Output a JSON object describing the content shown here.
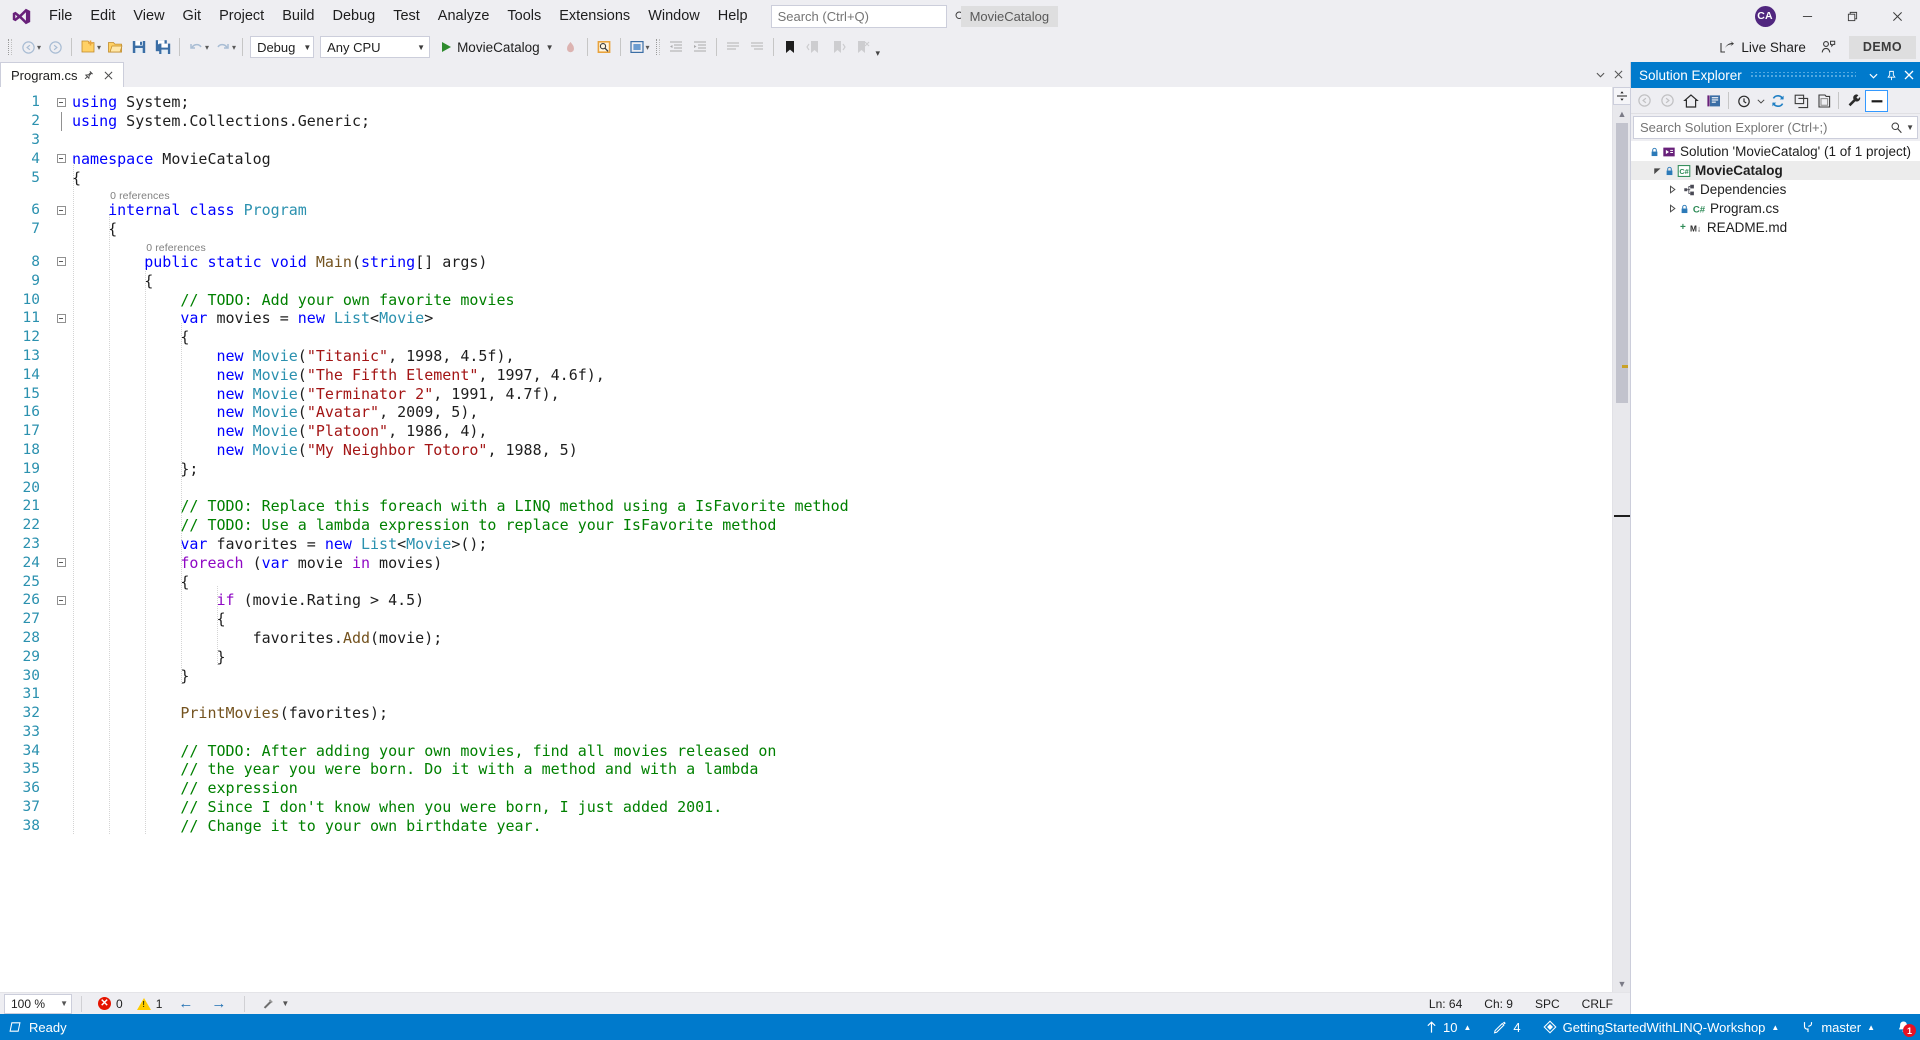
{
  "window": {
    "app_name": "Visual Studio",
    "solution_chip": "MovieCatalog",
    "avatar_initials": "CA",
    "minimize": "─",
    "maximize": "❐",
    "close": "✕"
  },
  "menu": {
    "items": [
      {
        "label": "File",
        "accel": "F"
      },
      {
        "label": "Edit",
        "accel": "E"
      },
      {
        "label": "View",
        "accel": "V"
      },
      {
        "label": "Git",
        "accel": "G"
      },
      {
        "label": "Project",
        "accel": "P"
      },
      {
        "label": "Build",
        "accel": "B"
      },
      {
        "label": "Debug",
        "accel": "D"
      },
      {
        "label": "Test",
        "accel": "T"
      },
      {
        "label": "Analyze",
        "accel": "n"
      },
      {
        "label": "Tools",
        "accel": "T"
      },
      {
        "label": "Extensions",
        "accel": "x"
      },
      {
        "label": "Window",
        "accel": "W"
      },
      {
        "label": "Help",
        "accel": "H"
      }
    ],
    "search_placeholder": "Search (Ctrl+Q)"
  },
  "toolbar": {
    "configuration": "Debug",
    "platform": "Any CPU",
    "start_project": "MovieCatalog",
    "live_share": "Live Share",
    "demo_label": "DEMO"
  },
  "tabs": {
    "active": "Program.cs",
    "pin_tooltip": "Pin Tab",
    "close_tooltip": "Close"
  },
  "editor": {
    "zoom": "100 %",
    "error_count": "0",
    "warning_count": "1",
    "line": "Ln: 64",
    "column": "Ch: 9",
    "spaces": "SPC",
    "line_endings": "CRLF",
    "first_line_number": 1,
    "lines": [
      {
        "n": 1,
        "fold": "minus",
        "indent": 0,
        "tokens": [
          {
            "t": "using",
            "c": "k"
          },
          {
            "t": " System;",
            "c": "p"
          }
        ]
      },
      {
        "n": 2,
        "fold": "bar",
        "indent": 0,
        "tokens": [
          {
            "t": "using",
            "c": "k"
          },
          {
            "t": " System.Collections.Generic;",
            "c": "p"
          }
        ]
      },
      {
        "n": 3,
        "fold": "",
        "indent": 0,
        "tokens": []
      },
      {
        "n": 4,
        "fold": "minus",
        "indent": 0,
        "tokens": [
          {
            "t": "namespace",
            "c": "k"
          },
          {
            "t": " MovieCatalog",
            "c": "p"
          }
        ]
      },
      {
        "n": 5,
        "fold": "",
        "indent": 0,
        "tokens": [
          {
            "t": "{",
            "c": "p"
          }
        ]
      },
      {
        "n": null,
        "codelens": "0 references",
        "indent": 1
      },
      {
        "n": 6,
        "fold": "minus",
        "indent": 1,
        "tokens": [
          {
            "t": "    ",
            "c": "p"
          },
          {
            "t": "internal class",
            "c": "k"
          },
          {
            "t": " ",
            "c": "p"
          },
          {
            "t": "Program",
            "c": "t"
          }
        ]
      },
      {
        "n": 7,
        "fold": "",
        "indent": 1,
        "tokens": [
          {
            "t": "    {",
            "c": "p"
          }
        ]
      },
      {
        "n": null,
        "codelens": "0 references",
        "indent": 2
      },
      {
        "n": 8,
        "fold": "minus",
        "indent": 2,
        "tokens": [
          {
            "t": "        ",
            "c": "p"
          },
          {
            "t": "public static void",
            "c": "k"
          },
          {
            "t": " ",
            "c": "p"
          },
          {
            "t": "Main",
            "c": "m"
          },
          {
            "t": "(",
            "c": "p"
          },
          {
            "t": "string",
            "c": "k"
          },
          {
            "t": "[] args)",
            "c": "p"
          }
        ]
      },
      {
        "n": 9,
        "fold": "",
        "indent": 2,
        "tokens": [
          {
            "t": "        {",
            "c": "p"
          }
        ]
      },
      {
        "n": 10,
        "fold": "",
        "indent": 3,
        "tokens": [
          {
            "t": "            ",
            "c": "p"
          },
          {
            "t": "// TODO: Add your own favorite movies",
            "c": "c"
          }
        ]
      },
      {
        "n": 11,
        "fold": "minus",
        "indent": 3,
        "tokens": [
          {
            "t": "            ",
            "c": "p"
          },
          {
            "t": "var",
            "c": "k"
          },
          {
            "t": " movies = ",
            "c": "p"
          },
          {
            "t": "new",
            "c": "k"
          },
          {
            "t": " ",
            "c": "p"
          },
          {
            "t": "List",
            "c": "t"
          },
          {
            "t": "<",
            "c": "p"
          },
          {
            "t": "Movie",
            "c": "t"
          },
          {
            "t": ">",
            "c": "p"
          }
        ]
      },
      {
        "n": 12,
        "fold": "",
        "indent": 3,
        "tokens": [
          {
            "t": "            {",
            "c": "p"
          }
        ]
      },
      {
        "n": 13,
        "fold": "",
        "indent": 4,
        "tokens": [
          {
            "t": "                ",
            "c": "p"
          },
          {
            "t": "new",
            "c": "k"
          },
          {
            "t": " ",
            "c": "p"
          },
          {
            "t": "Movie",
            "c": "t"
          },
          {
            "t": "(",
            "c": "p"
          },
          {
            "t": "\"Titanic\"",
            "c": "s"
          },
          {
            "t": ", 1998, 4.5f),",
            "c": "p"
          }
        ]
      },
      {
        "n": 14,
        "fold": "",
        "indent": 4,
        "tokens": [
          {
            "t": "                ",
            "c": "p"
          },
          {
            "t": "new",
            "c": "k"
          },
          {
            "t": " ",
            "c": "p"
          },
          {
            "t": "Movie",
            "c": "t"
          },
          {
            "t": "(",
            "c": "p"
          },
          {
            "t": "\"The Fifth Element\"",
            "c": "s"
          },
          {
            "t": ", 1997, 4.6f),",
            "c": "p"
          }
        ]
      },
      {
        "n": 15,
        "fold": "",
        "indent": 4,
        "tokens": [
          {
            "t": "                ",
            "c": "p"
          },
          {
            "t": "new",
            "c": "k"
          },
          {
            "t": " ",
            "c": "p"
          },
          {
            "t": "Movie",
            "c": "t"
          },
          {
            "t": "(",
            "c": "p"
          },
          {
            "t": "\"Terminator 2\"",
            "c": "s"
          },
          {
            "t": ", 1991, 4.7f),",
            "c": "p"
          }
        ]
      },
      {
        "n": 16,
        "fold": "",
        "indent": 4,
        "tokens": [
          {
            "t": "                ",
            "c": "p"
          },
          {
            "t": "new",
            "c": "k"
          },
          {
            "t": " ",
            "c": "p"
          },
          {
            "t": "Movie",
            "c": "t"
          },
          {
            "t": "(",
            "c": "p"
          },
          {
            "t": "\"Avatar\"",
            "c": "s"
          },
          {
            "t": ", 2009, 5),",
            "c": "p"
          }
        ]
      },
      {
        "n": 17,
        "fold": "",
        "indent": 4,
        "tokens": [
          {
            "t": "                ",
            "c": "p"
          },
          {
            "t": "new",
            "c": "k"
          },
          {
            "t": " ",
            "c": "p"
          },
          {
            "t": "Movie",
            "c": "t"
          },
          {
            "t": "(",
            "c": "p"
          },
          {
            "t": "\"Platoon\"",
            "c": "s"
          },
          {
            "t": ", 1986, 4),",
            "c": "p"
          }
        ]
      },
      {
        "n": 18,
        "fold": "",
        "indent": 4,
        "tokens": [
          {
            "t": "                ",
            "c": "p"
          },
          {
            "t": "new",
            "c": "k"
          },
          {
            "t": " ",
            "c": "p"
          },
          {
            "t": "Movie",
            "c": "t"
          },
          {
            "t": "(",
            "c": "p"
          },
          {
            "t": "\"My Neighbor Totoro\"",
            "c": "s"
          },
          {
            "t": ", 1988, 5)",
            "c": "p"
          }
        ]
      },
      {
        "n": 19,
        "fold": "",
        "indent": 3,
        "tokens": [
          {
            "t": "            };",
            "c": "p"
          }
        ]
      },
      {
        "n": 20,
        "fold": "",
        "indent": 3,
        "tokens": []
      },
      {
        "n": 21,
        "fold": "",
        "indent": 3,
        "tokens": [
          {
            "t": "            ",
            "c": "p"
          },
          {
            "t": "// TODO: Replace this foreach with a LINQ method using a IsFavorite method",
            "c": "c"
          }
        ]
      },
      {
        "n": 22,
        "fold": "",
        "indent": 3,
        "tokens": [
          {
            "t": "            ",
            "c": "p"
          },
          {
            "t": "// TODO: Use a lambda expression to replace your IsFavorite method",
            "c": "c"
          }
        ]
      },
      {
        "n": 23,
        "fold": "",
        "indent": 3,
        "tokens": [
          {
            "t": "            ",
            "c": "p"
          },
          {
            "t": "var",
            "c": "k"
          },
          {
            "t": " favorites = ",
            "c": "p"
          },
          {
            "t": "new",
            "c": "k"
          },
          {
            "t": " ",
            "c": "p"
          },
          {
            "t": "List",
            "c": "t"
          },
          {
            "t": "<",
            "c": "p"
          },
          {
            "t": "Movie",
            "c": "t"
          },
          {
            "t": ">();",
            "c": "p"
          }
        ]
      },
      {
        "n": 24,
        "fold": "minus",
        "indent": 3,
        "tokens": [
          {
            "t": "            ",
            "c": "p"
          },
          {
            "t": "foreach",
            "c": "kc"
          },
          {
            "t": " (",
            "c": "p"
          },
          {
            "t": "var",
            "c": "k"
          },
          {
            "t": " movie ",
            "c": "p"
          },
          {
            "t": "in",
            "c": "kc"
          },
          {
            "t": " movies)",
            "c": "p"
          }
        ]
      },
      {
        "n": 25,
        "fold": "",
        "indent": 3,
        "tokens": [
          {
            "t": "            {",
            "c": "p"
          }
        ]
      },
      {
        "n": 26,
        "fold": "minus",
        "indent": 4,
        "tokens": [
          {
            "t": "                ",
            "c": "p"
          },
          {
            "t": "if",
            "c": "kc"
          },
          {
            "t": " (movie.Rating > 4.5)",
            "c": "p"
          }
        ]
      },
      {
        "n": 27,
        "fold": "",
        "indent": 4,
        "tokens": [
          {
            "t": "                {",
            "c": "p"
          }
        ]
      },
      {
        "n": 28,
        "fold": "",
        "indent": 5,
        "tokens": [
          {
            "t": "                    favorites.",
            "c": "p"
          },
          {
            "t": "Add",
            "c": "m"
          },
          {
            "t": "(movie);",
            "c": "p"
          }
        ]
      },
      {
        "n": 29,
        "fold": "",
        "indent": 4,
        "tokens": [
          {
            "t": "                }",
            "c": "p"
          }
        ]
      },
      {
        "n": 30,
        "fold": "",
        "indent": 3,
        "tokens": [
          {
            "t": "            }",
            "c": "p"
          }
        ]
      },
      {
        "n": 31,
        "fold": "",
        "indent": 3,
        "tokens": []
      },
      {
        "n": 32,
        "fold": "",
        "indent": 3,
        "tokens": [
          {
            "t": "            ",
            "c": "p"
          },
          {
            "t": "PrintMovies",
            "c": "m"
          },
          {
            "t": "(favorites);",
            "c": "p"
          }
        ]
      },
      {
        "n": 33,
        "fold": "",
        "indent": 3,
        "tokens": []
      },
      {
        "n": 34,
        "fold": "",
        "indent": 3,
        "tokens": [
          {
            "t": "            ",
            "c": "p"
          },
          {
            "t": "// TODO: After adding your own movies, find all movies released on",
            "c": "c"
          }
        ]
      },
      {
        "n": 35,
        "fold": "",
        "indent": 3,
        "tokens": [
          {
            "t": "            ",
            "c": "p"
          },
          {
            "t": "// the year you were born. Do it with a method and with a lambda",
            "c": "c"
          }
        ]
      },
      {
        "n": 36,
        "fold": "",
        "indent": 3,
        "tokens": [
          {
            "t": "            ",
            "c": "p"
          },
          {
            "t": "// expression",
            "c": "c"
          }
        ]
      },
      {
        "n": 37,
        "fold": "",
        "indent": 3,
        "tokens": [
          {
            "t": "            ",
            "c": "p"
          },
          {
            "t": "// Since I don't know when you were born, I just added 2001.",
            "c": "c"
          }
        ]
      },
      {
        "n": 38,
        "fold": "",
        "indent": 3,
        "tokens": [
          {
            "t": "            ",
            "c": "p"
          },
          {
            "t": "// Change it to your own birthdate year.",
            "c": "c"
          }
        ]
      }
    ]
  },
  "solution_explorer": {
    "title": "Solution Explorer",
    "search_placeholder": "Search Solution Explorer (Ctrl+;)",
    "tree": [
      {
        "label": "Solution 'MovieCatalog' (1 of 1 project)",
        "depth": 0,
        "icon": "solution-icon",
        "expander": "",
        "locked": true,
        "selected": false
      },
      {
        "label": "MovieCatalog",
        "depth": 1,
        "icon": "csharp-project-icon",
        "expander": "expanded",
        "locked": true,
        "selected": true
      },
      {
        "label": "Dependencies",
        "depth": 2,
        "icon": "dependencies-icon",
        "expander": "collapsed",
        "locked": false,
        "selected": false
      },
      {
        "label": "Program.cs",
        "depth": 2,
        "icon": "csharp-file-icon",
        "expander": "collapsed",
        "locked": true,
        "selected": false
      },
      {
        "label": "README.md",
        "depth": 2,
        "icon": "markdown-file-icon",
        "expander": "",
        "locked": false,
        "selected": false,
        "git_status": "+"
      }
    ]
  },
  "statusbar": {
    "status": "Ready",
    "outgoing_commits": "10",
    "pending_changes": "4",
    "repository": "GettingStartedWithLINQ-Workshop",
    "branch": "master",
    "notification_count": "1"
  }
}
